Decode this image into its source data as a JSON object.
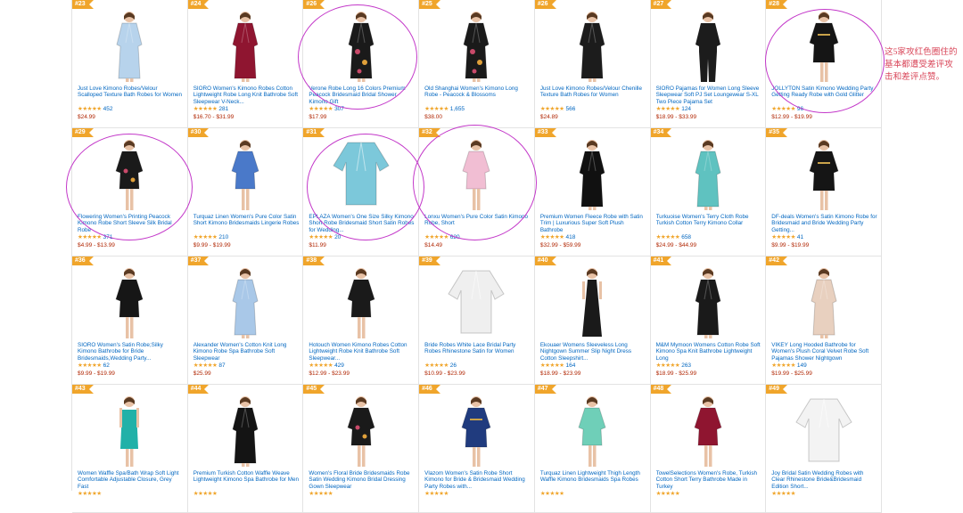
{
  "colors": {
    "rank_badge": "#f0a52b",
    "title_link": "#0066c0",
    "price": "#b12704",
    "star": "#f0a52b",
    "circle_annotation": "#c338c9",
    "annotation_text": "#d9475a"
  },
  "annotation_note": "这5家攻红色圈住的基本都遭受差评攻击和差评点赞。",
  "products": [
    {
      "rank": "#23",
      "title": "Just Love Kimono Robes/Velour Scalloped Texture Bath Robes for Women",
      "stars": "★★★★★",
      "reviews": "452",
      "price": "$24.99",
      "robe_color": "#b7d3ec",
      "robe_style": "long"
    },
    {
      "rank": "#24",
      "title": "SIORO Women's Kimono Robes Cotton Lightweight Robe Long Knit Bathrobe Soft Sleepwear V-Neck...",
      "stars": "★★★★★",
      "reviews": "281",
      "price": "$16.70 - $31.99",
      "robe_color": "#8f1530",
      "robe_style": "long"
    },
    {
      "rank": "#26",
      "title": "Verone Robe Long 16 Colors Premium Peacock Bridesmaid Bridal Shower Kimono Gift",
      "stars": "★★★★★",
      "reviews": "307",
      "price": "$17.99",
      "robe_color": "#1a1a1a",
      "robe_style": "floral"
    },
    {
      "rank": "#25",
      "title": "Old Shanghai Women's Kimono Long Robe - Peacock & Blossoms",
      "stars": "★★★★★",
      "reviews": "1,655",
      "price": "$38.00",
      "robe_color": "#1a1a1a",
      "robe_style": "floral"
    },
    {
      "rank": "#26",
      "title": "Just Love Kimono Robes/Velour Chenille Texture Bath Robes for Women",
      "stars": "★★★★★",
      "reviews": "566",
      "price": "$24.89",
      "robe_color": "#1c1c1c",
      "robe_style": "long"
    },
    {
      "rank": "#27",
      "title": "SIORO Pajamas for Women Long Sleeve Sleepwear Soft PJ Set Loungewear S-XL Two Piece Pajama Set",
      "stars": "★★★★★",
      "reviews": "124",
      "price": "$18.99 - $33.99",
      "robe_color": "#1c1c1c",
      "robe_style": "pajama"
    },
    {
      "rank": "#28",
      "title": "JOLLYTON Satin Kimono Wedding Party Getting Ready Robe with Gold Glitter",
      "stars": "★★★★★",
      "reviews": "96",
      "price": "$12.99 - $19.99",
      "robe_color": "#151515",
      "robe_style": "back"
    },
    {
      "rank": "#29",
      "title": "Flowering Women's Printing Peacock Kimono Robe Short Sleeve Silk Bridal Robe",
      "stars": "★★★★★",
      "reviews": "371",
      "price": "$4.99 - $13.99",
      "robe_color": "#1a1a1a",
      "robe_style": "floral-short"
    },
    {
      "rank": "#30",
      "title": "Turquaz Linen Women's Pure Color Satin Short Kimono Bridesmaids Lingerie Robes",
      "stars": "★★★★★",
      "reviews": "210",
      "price": "$9.99 - $19.99",
      "robe_color": "#4a79c9",
      "robe_style": "short"
    },
    {
      "rank": "#31",
      "title": "EPLAZA Women's One Size Silky Kimono Short Robe Bridesmaid Short Satin Robes for Wedding...",
      "stars": "★★★★★",
      "reviews": "20",
      "price": "$11.99",
      "robe_color": "#7cc8da",
      "robe_style": "flat"
    },
    {
      "rank": "#32",
      "title": "Lonxu Women's Pure Color Satin Kimono Robe, Short",
      "stars": "★★★★★",
      "reviews": "620",
      "price": "$14.49",
      "robe_color": "#f1bed3",
      "robe_style": "short"
    },
    {
      "rank": "#33",
      "title": "Premium Women Fleece Robe with Satin Trim | Luxurious Super Soft Plush Bathrobe",
      "stars": "★★★★★",
      "reviews": "418",
      "price": "$32.99 - $59.99",
      "robe_color": "#111111",
      "robe_style": "long"
    },
    {
      "rank": "#34",
      "title": "Turkuoise Women's Terry Cloth Robe Turkish Cotton Terry Kimono Collar",
      "stars": "★★★★★",
      "reviews": "658",
      "price": "$24.99 - $44.99",
      "robe_color": "#5fc2c0",
      "robe_style": "long"
    },
    {
      "rank": "#35",
      "title": "DF-deals Women's Satin Kimono Robe for Bridesmaid and Bride Wedding Party Getting...",
      "stars": "★★★★★",
      "reviews": "41",
      "price": "$9.99 - $19.99",
      "robe_color": "#151515",
      "robe_style": "back"
    },
    {
      "rank": "#36",
      "title": "SIORO Women's Satin Robe;Silky Kimono Bathrobe for Bride Bridesmaids,Wedding Party...",
      "stars": "★★★★★",
      "reviews": "62",
      "price": "$9.99 - $19.99",
      "robe_color": "#161616",
      "robe_style": "short"
    },
    {
      "rank": "#37",
      "title": "Alexander Women's Cotton Knit Long Kimono Robe Spa Bathrobe Soft Sleepwear",
      "stars": "★★★★★",
      "reviews": "87",
      "price": "$25.99",
      "robe_color": "#a9c8e8",
      "robe_style": "long"
    },
    {
      "rank": "#38",
      "title": "Hotouch Women Kimono Robes Cotton Lightweight Robe Knit Bathrobe Soft Sleepwear...",
      "stars": "★★★★★",
      "reviews": "429",
      "price": "$12.99 - $23.99",
      "robe_color": "#1a1a1a",
      "robe_style": "short"
    },
    {
      "rank": "#39",
      "title": "Bride Robes White Lace Bridal Party Robes Rhinestone Satin for Women",
      "stars": "★★★★★",
      "reviews": "26",
      "price": "$10.99 - $23.99",
      "robe_color": "#efefef",
      "robe_style": "flat"
    },
    {
      "rank": "#40",
      "title": "Ekouaer Womens Sleeveless Long Nightgown Summer Slip Night Dress Cotton Sleepshirt...",
      "stars": "★★★★★",
      "reviews": "164",
      "price": "$18.99 - $23.99",
      "robe_color": "#1a1a1a",
      "robe_style": "dress"
    },
    {
      "rank": "#41",
      "title": "M&M Mymoon Womens Cotton Robe Soft Kimono Spa Knit Bathrobe Lightweight Long",
      "stars": "★★★★★",
      "reviews": "263",
      "price": "$18.99 - $25.99",
      "robe_color": "#1a1a1a",
      "robe_style": "long"
    },
    {
      "rank": "#42",
      "title": "VIKEY Long Hooded Bathrobe for Women's Plush Coral Velvet Robe Soft Pajamas Shower Nightgown",
      "stars": "★★★★★",
      "reviews": "149",
      "price": "$19.99 - $25.99",
      "robe_color": "#e8d0bf",
      "robe_style": "long"
    },
    {
      "rank": "#43",
      "title": "Women Waffle Spa/Bath Wrap Soft Light Comfortable Adjustable Closure, Grey Fast",
      "stars": "★★★★★",
      "reviews": "",
      "price": "",
      "robe_color": "#21b1a8",
      "robe_style": "wrap"
    },
    {
      "rank": "#44",
      "title": "Premium Turkish Cotton Waffle Weave Lightweight Kimono Spa Bathrobe for Men",
      "stars": "★★★★★",
      "reviews": "",
      "price": "",
      "robe_color": "#141414",
      "robe_style": "long"
    },
    {
      "rank": "#45",
      "title": "Women's Floral Bride Bridesmaids Robe Satin Wedding Kimono Bridal Dressing Gown Sleepwear",
      "stars": "★★★★★",
      "reviews": "",
      "price": "",
      "robe_color": "#1a1a1a",
      "robe_style": "floral-short"
    },
    {
      "rank": "#46",
      "title": "Vlazom Women's Satin Robe Short Kimono for Bride & Bridesmaid Wedding Party Robes with...",
      "stars": "★★★★★",
      "reviews": "",
      "price": "",
      "robe_color": "#203b7e",
      "robe_style": "back"
    },
    {
      "rank": "#47",
      "title": "Turquaz Linen Lightweight Thigh Length Waffle Kimono Bridesmaids Spa Robes",
      "stars": "★★★★★",
      "reviews": "",
      "price": "",
      "robe_color": "#6fcfb8",
      "robe_style": "short"
    },
    {
      "rank": "#48",
      "title": "TowelSelections Women's Robe, Turkish Cotton Short Terry Bathrobe Made in Turkey",
      "stars": "★★★★★",
      "reviews": "",
      "price": "",
      "robe_color": "#8f1530",
      "robe_style": "short"
    },
    {
      "rank": "#49",
      "title": "Joy Bridal Satin Wedding Robes with Clear Rhinestone Bride&Bridesmaid Edition Short...",
      "stars": "★★★★★",
      "reviews": "",
      "price": "",
      "robe_color": "#f3f3f3",
      "robe_style": "flat"
    }
  ]
}
